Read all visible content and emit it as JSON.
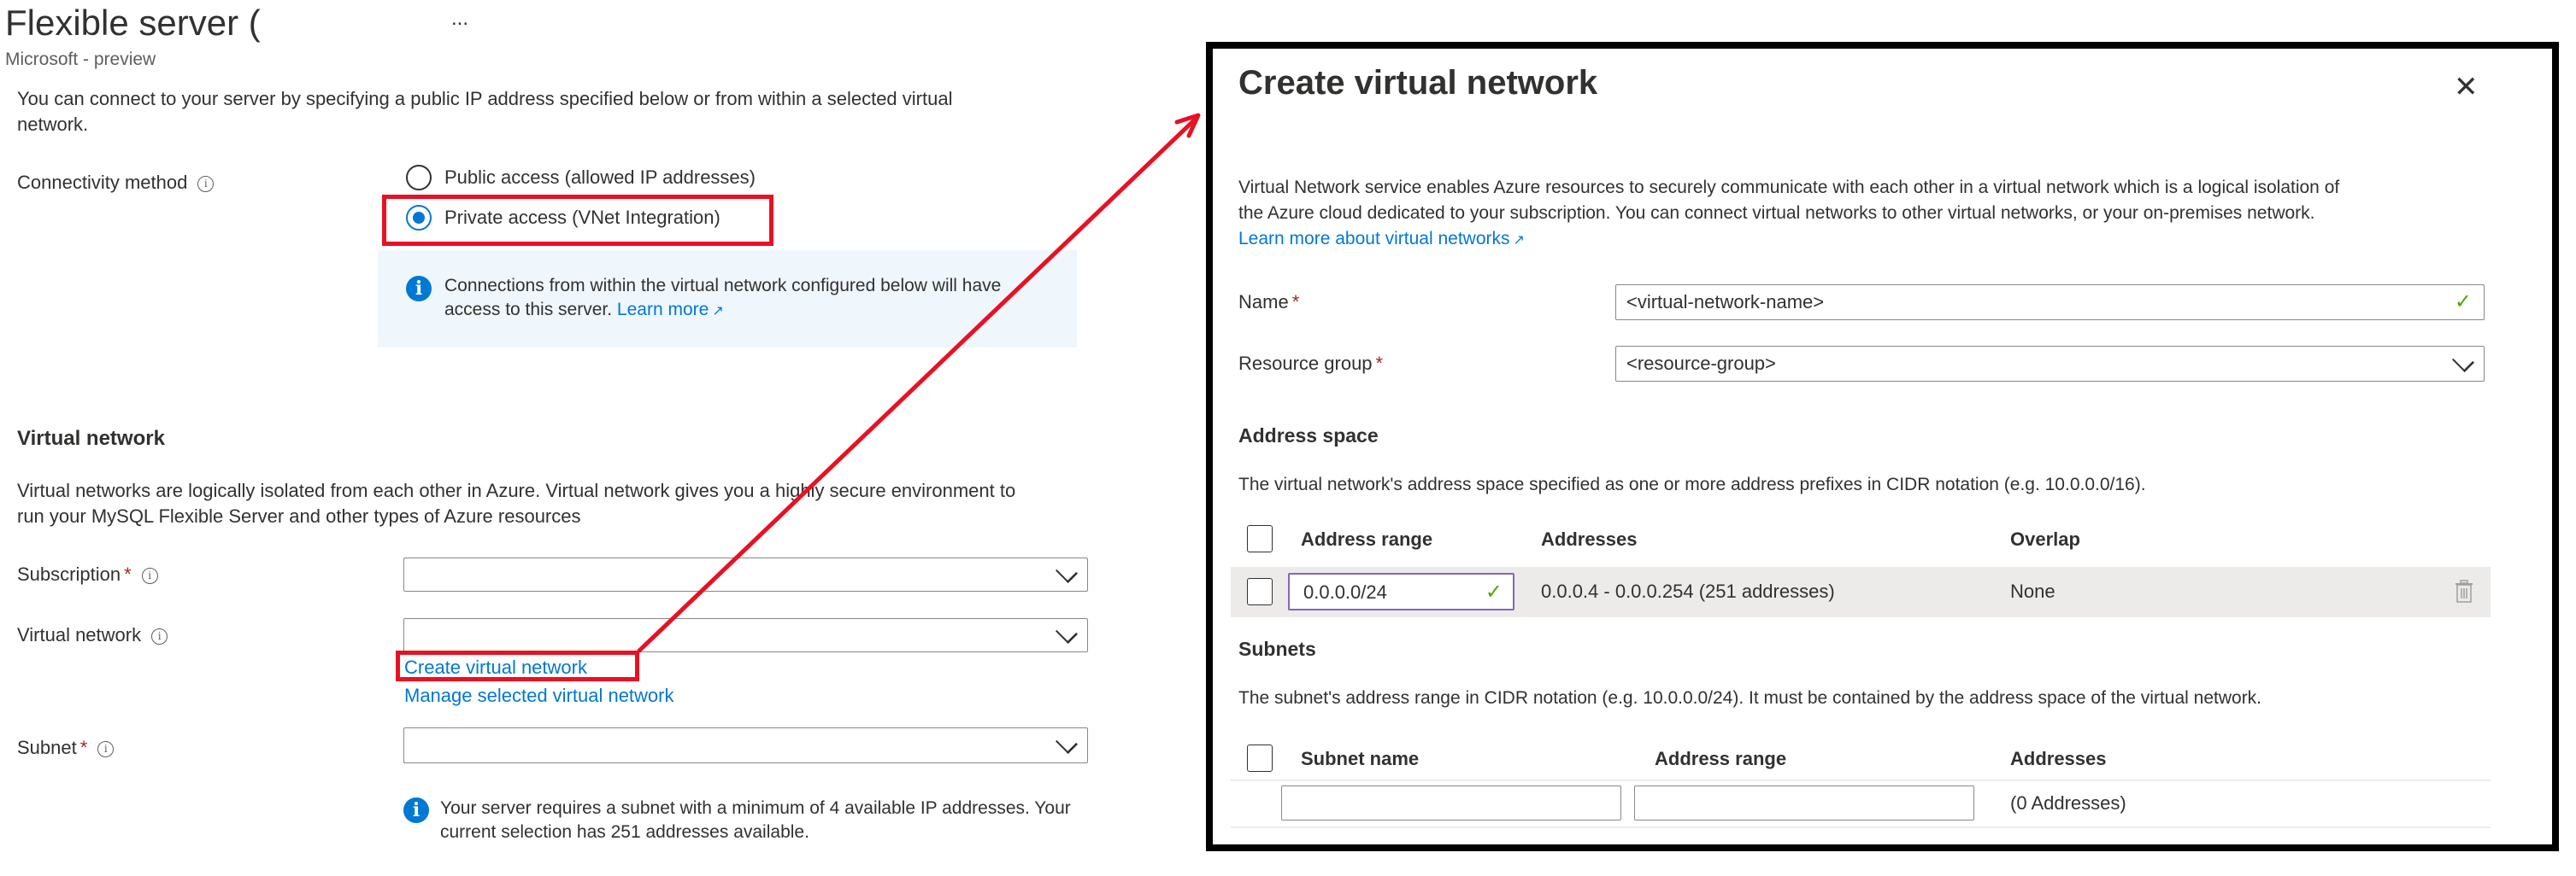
{
  "header": {
    "title": "Flexible server (",
    "more_label": "...",
    "subtitle": "Microsoft - preview"
  },
  "networking": {
    "intro_line1": "You can connect to your server by specifying a public IP address specified below or from within a selected virtual",
    "intro_line2": "network.",
    "connectivity_label": "Connectivity method",
    "options": [
      {
        "label": "Public access (allowed IP addresses)",
        "selected": false
      },
      {
        "label": "Private access (VNet Integration)",
        "selected": true
      }
    ],
    "info_line1": "Connections from within the virtual network configured below will have",
    "info_line2": "access to this server.",
    "info_link": "Learn more"
  },
  "virtual_network": {
    "heading": "Virtual network",
    "desc_line1": "Virtual networks are logically isolated from each other in Azure. Virtual network gives you a highly secure environment to",
    "desc_line2": "run your MySQL Flexible Server and other types of Azure resources",
    "subscription_label": "Subscription",
    "subscription_value": "",
    "vnet_label": "Virtual network",
    "vnet_value": "",
    "create_link": "Create virtual network",
    "manage_link": "Manage selected virtual network",
    "subnet_label": "Subnet",
    "subnet_value": "",
    "subnet_info_line1": "Your server requires a subnet with a minimum of 4 available IP addresses. Your",
    "subnet_info_line2": "current selection has 251 addresses available.",
    "required_mark": "*"
  },
  "dialog": {
    "title": "Create virtual network",
    "close_label": "✕",
    "desc_line1": "Virtual Network service enables Azure resources to securely communicate with each other in a virtual network which is a logical isolation of",
    "desc_line2": "the Azure cloud dedicated to your subscription. You can connect virtual networks to other virtual networks, or your on-premises network.",
    "learn_more": "Learn more about virtual networks",
    "name_label": "Name",
    "name_value": "<virtual-network-name>",
    "rg_label": "Resource group",
    "rg_value": "<resource-group>",
    "address_space": {
      "heading": "Address space",
      "desc": "The virtual network's address space specified as one or more address prefixes in CIDR notation (e.g. 10.0.0.0/16).",
      "columns": [
        "Address range",
        "Addresses",
        "Overlap"
      ],
      "rows": [
        {
          "range": "0.0.0.0/24",
          "addresses": "0.0.0.4 - 0.0.0.254 (251 addresses)",
          "overlap": "None"
        }
      ]
    },
    "subnets": {
      "heading": "Subnets",
      "desc": "The subnet's address range in CIDR notation (e.g. 10.0.0.0/24). It must be contained by the address space of the virtual network.",
      "columns": [
        "Subnet name",
        "Address range",
        "Addresses"
      ],
      "new_row": {
        "name": "",
        "range": "",
        "addresses": "(0 Addresses)"
      }
    }
  },
  "annotations": {
    "highlight_color": "#e81123",
    "accent_color": "#0078d4"
  }
}
